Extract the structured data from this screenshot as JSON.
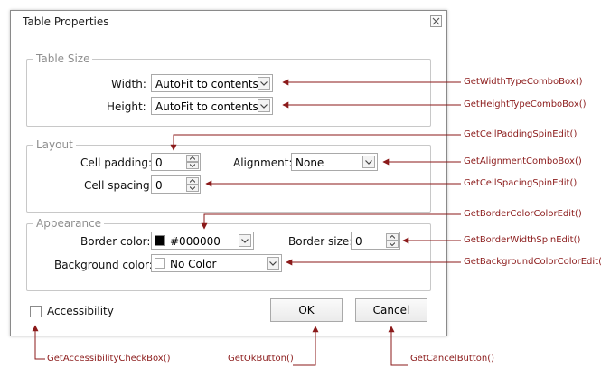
{
  "dialog": {
    "title": "Table Properties",
    "close_icon": "close-icon"
  },
  "table_size": {
    "legend": "Table Size",
    "width_label": "Width:",
    "width_value": "AutoFit to contents",
    "height_label": "Height:",
    "height_value": "AutoFit to contents"
  },
  "layout": {
    "legend": "Layout",
    "cell_padding_label": "Cell padding:",
    "cell_padding_value": "0",
    "cell_spacing_label": "Cell spacing:",
    "cell_spacing_value": "0",
    "alignment_label": "Alignment:",
    "alignment_value": "None"
  },
  "appearance": {
    "legend": "Appearance",
    "border_color_label": "Border color:",
    "border_color_value": "#000000",
    "border_color_swatch": "#000000",
    "border_size_label": "Border size:",
    "border_size_value": "0",
    "background_color_label": "Background color:",
    "background_color_value": "No Color",
    "background_color_swatch": "#ffffff"
  },
  "footer": {
    "accessibility_label": "Accessibility",
    "ok_label": "OK",
    "cancel_label": "Cancel"
  },
  "annotations": {
    "width_type": "GetWidthTypeComboBox()",
    "height_type": "GetHeightTypeComboBox()",
    "cell_padding": "GetCellPaddingSpinEdit()",
    "alignment": "GetAlignmentComboBox()",
    "cell_spacing": "GetCellSpacingSpinEdit()",
    "border_color": "GetBorderColorColorEdit()",
    "border_width": "GetBorderWidthSpinEdit()",
    "background_color": "GetBackgroundColorColorEdit()",
    "accessibility": "GetAccessibilityCheckBox()",
    "ok": "GetOkButton()",
    "cancel": "GetCancelButton()"
  },
  "colors": {
    "annotation": "#8b1a1a",
    "group_border": "#c8c8c8",
    "legend_text": "#8e8e8e"
  }
}
